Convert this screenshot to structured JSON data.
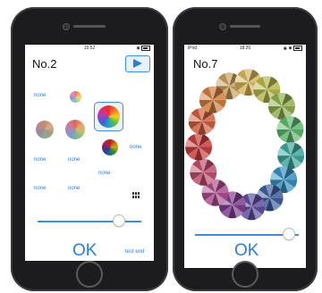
{
  "phone_left": {
    "status": {
      "time": "15:52"
    },
    "title": "No.2",
    "none_labels": [
      "none",
      "none",
      "none",
      "none",
      "none",
      "none",
      "none"
    ],
    "slider_value": 0.82,
    "ok_label": "OK",
    "test_end_label": "test end"
  },
  "phone_right": {
    "status": {
      "carrier": "iPod",
      "time": "18:20"
    },
    "title": "No.7",
    "slider_value": 0.95,
    "ok_label": "OK",
    "ring_colors": [
      "#c8a060",
      "#d8b860",
      "#b8b850",
      "#90b050",
      "#60b870",
      "#40a8a0",
      "#3890c0",
      "#4060a0",
      "#6050a0",
      "#804090",
      "#b05090",
      "#c05070",
      "#c84040",
      "#d06040",
      "#d08040"
    ]
  }
}
